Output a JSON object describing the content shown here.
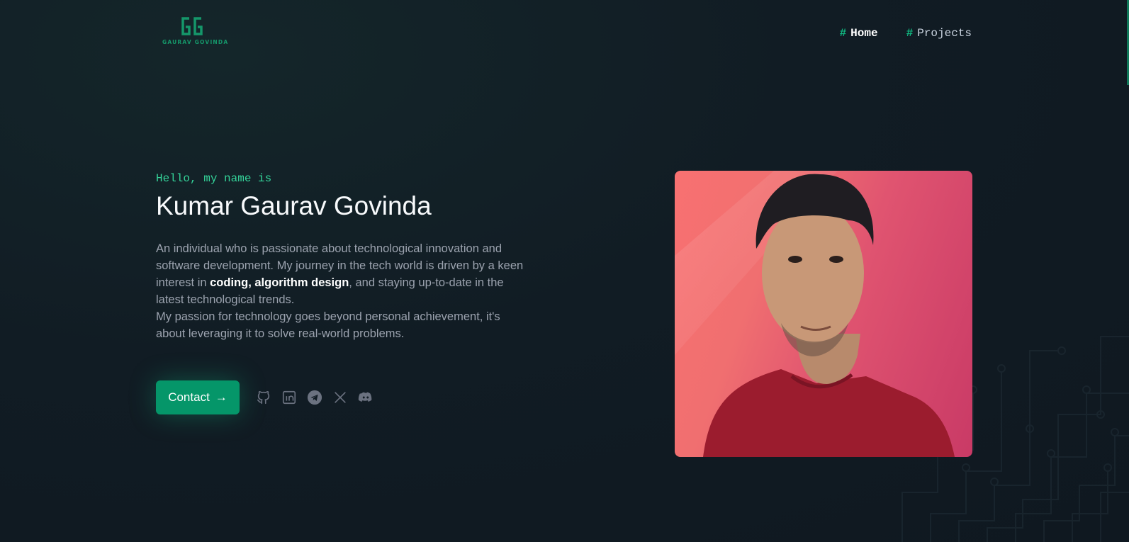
{
  "brand": {
    "name": "GAURAV GOVINDA"
  },
  "nav": [
    {
      "hash": "#",
      "label": "Home",
      "active": true
    },
    {
      "hash": "#",
      "label": "Projects",
      "active": false
    }
  ],
  "hero": {
    "greeting": "Hello, my name is",
    "name": "Kumar Gaurav Govinda",
    "bio_1_pre": "An individual who is passionate about technological innovation and software development. My journey in the tech world is driven by a keen interest in ",
    "bio_1_bold": "coding, algorithm design",
    "bio_1_post": ", and staying up-to-date in the latest technological trends.",
    "bio_2": "My passion for technology goes beyond personal achievement, it's about leveraging it to solve real-world problems.",
    "contact_label": "Contact",
    "contact_arrow": "→"
  },
  "socials": [
    "github-icon",
    "linkedin-icon",
    "telegram-icon",
    "x-icon",
    "discord-icon"
  ],
  "colors": {
    "accent": "#10b981",
    "button": "#059669",
    "background": "#111c24"
  }
}
